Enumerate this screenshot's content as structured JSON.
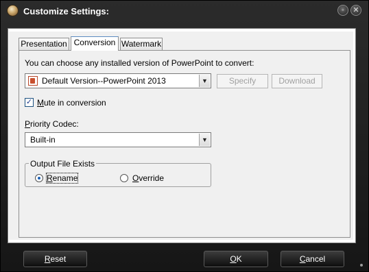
{
  "window": {
    "title": "Customize Settings:",
    "icon": "app-logo-icon",
    "controls": {
      "minimize": "◦",
      "close": "✕"
    }
  },
  "tabs": [
    {
      "label": "Presentation",
      "active": false
    },
    {
      "label": "Conversion",
      "active": true
    },
    {
      "label": "Watermark",
      "active": false
    }
  ],
  "conversion": {
    "version_prompt": "You can choose any installed version of PowerPoint to convert:",
    "version_select": {
      "value": "Default Version--PowerPoint 2013",
      "icon": "powerpoint-icon"
    },
    "specify_label": "Specify",
    "download_label": "Download",
    "mute": {
      "checked": true,
      "label_mnemonic": "M",
      "label_rest": "ute in conversion"
    },
    "codec": {
      "label_mnemonic": "P",
      "label_rest": "riority Codec:",
      "value": "Built-in"
    },
    "output_exists": {
      "title": "Output File Exists",
      "options": [
        {
          "mnemonic": "R",
          "rest": "ename",
          "checked": true
        },
        {
          "mnemonic": "O",
          "rest": "verride",
          "checked": false
        }
      ]
    }
  },
  "footer": {
    "reset": {
      "mnemonic": "R",
      "rest": "eset"
    },
    "ok": {
      "mnemonic": "O",
      "rest": "K"
    },
    "cancel": {
      "mnemonic": "C",
      "rest": "ancel"
    }
  },
  "colors": {
    "frame": "#1b1b1b",
    "panel": "#f0f0f0",
    "accent": "#1a5fb4"
  }
}
